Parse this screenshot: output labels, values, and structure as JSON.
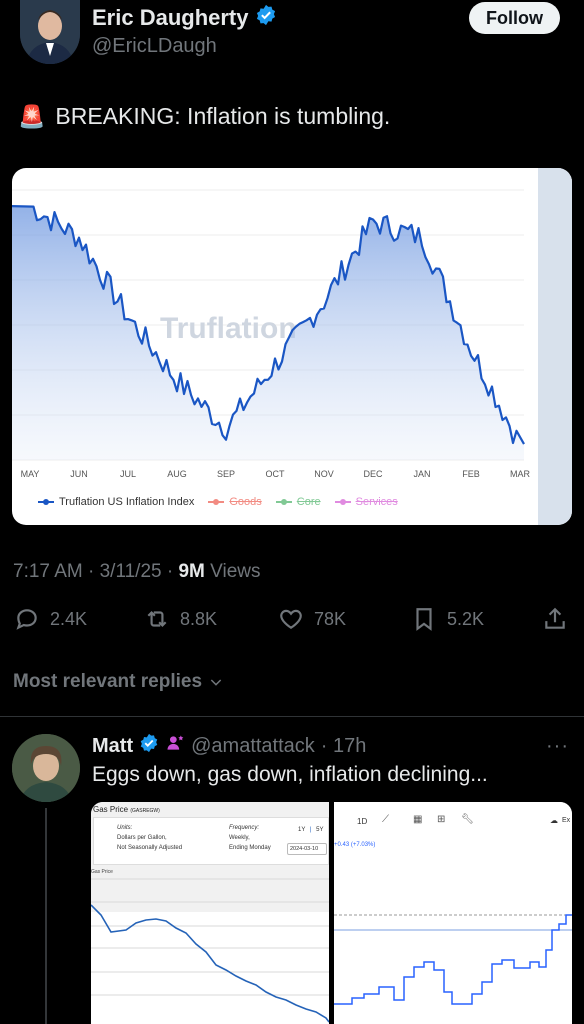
{
  "author": {
    "name": "Eric Daugherty",
    "handle": "@EricLDaugh",
    "follow_label": "Follow"
  },
  "tweet": {
    "emoji": "🚨",
    "text": "BREAKING: Inflation is tumbling."
  },
  "chart_data": {
    "type": "line",
    "title": "",
    "watermark": "Truflation",
    "x_ticks": [
      "MAY",
      "JUN",
      "JUL",
      "AUG",
      "SEP",
      "OCT",
      "NOV",
      "DEC",
      "JAN",
      "FEB",
      "MAR"
    ],
    "series": [
      {
        "name": "Truflation US Inflation Index",
        "color": "#1a56c4",
        "x": [
          "MAY",
          "JUN",
          "JUL",
          "AUG",
          "SEP",
          "OCT",
          "NOV",
          "DEC",
          "JAN",
          "FEB",
          "MAR"
        ],
        "values": [
          3.0,
          2.8,
          2.3,
          1.9,
          1.6,
          2.0,
          2.4,
          2.9,
          2.8,
          2.1,
          1.5
        ]
      }
    ],
    "legend": [
      {
        "label": "Truflation US Inflation Index",
        "color": "#1a56c4",
        "active": true
      },
      {
        "label": "Goods",
        "color": "#f28b82",
        "active": false
      },
      {
        "label": "Core",
        "color": "#81c995",
        "active": false
      },
      {
        "label": "Services",
        "color": "#e08be0",
        "active": false
      }
    ],
    "legend_position": "bottom-left",
    "grid": true
  },
  "meta": {
    "time": "7:17 AM · 3/11/25 · ",
    "views_count": "9M",
    "views_label": " Views"
  },
  "actions": {
    "replies": "2.4K",
    "reposts": "8.8K",
    "likes": "78K",
    "bookmarks": "5.2K"
  },
  "replies_header": "Most relevant replies",
  "reply": {
    "name": "Matt",
    "handle": "@amattattack",
    "time": "· 17h",
    "more": "···",
    "text": "Eggs down, gas down, inflation declining..."
  },
  "reply_images": {
    "left": {
      "title": "Gas Price",
      "code": "(GASREGW)",
      "units_label": "Units:",
      "units_value_1": "Dollars per Gallon,",
      "units_value_2": "Not Seasonally Adjusted",
      "freq_label": "Frequency:",
      "freq_value_1": "Weekly,",
      "freq_value_2": "Ending Monday",
      "range_1": "1Y",
      "range_2": "5Y",
      "date": "2024-03-10",
      "axis_label": "Gas Price"
    },
    "right": {
      "interval": "1D",
      "change": "+0.43 (+7.03%)",
      "cut_label": "Ex"
    }
  },
  "colors": {
    "accent": "#1d9bf0",
    "verified": "#1d9bf0",
    "line": "#1a56c4"
  }
}
